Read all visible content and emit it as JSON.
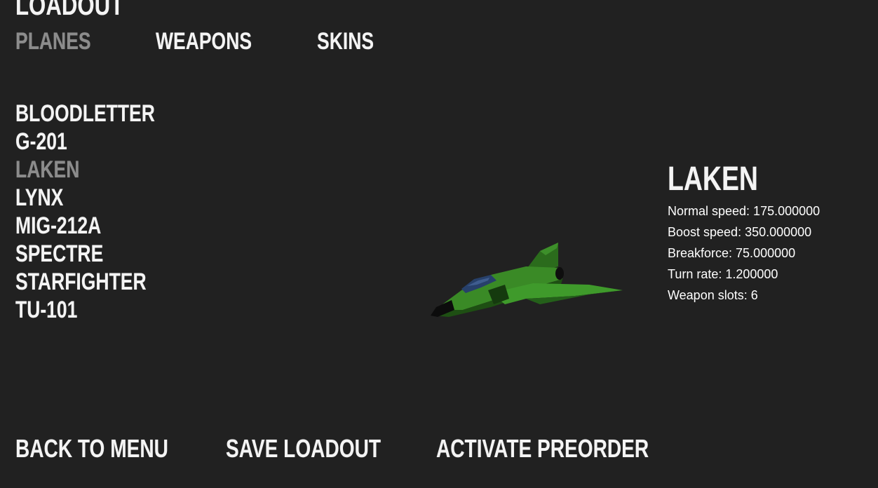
{
  "screen": {
    "title": "LOADOUT"
  },
  "tabs": [
    {
      "label": "PLANES",
      "active": true
    },
    {
      "label": "WEAPONS",
      "active": false
    },
    {
      "label": "SKINS",
      "active": false
    }
  ],
  "planes": [
    {
      "label": "BLOODLETTER",
      "selected": false
    },
    {
      "label": "G-201",
      "selected": false
    },
    {
      "label": "LAKEN",
      "selected": true
    },
    {
      "label": "LYNX",
      "selected": false
    },
    {
      "label": "MIG-212A",
      "selected": false
    },
    {
      "label": "SPECTRE",
      "selected": false
    },
    {
      "label": "STARFIGHTER",
      "selected": false
    },
    {
      "label": "TU-101",
      "selected": false
    }
  ],
  "selected_plane": {
    "name": "LAKEN",
    "stats": [
      {
        "text": "Normal speed: 175.000000"
      },
      {
        "text": "Boost speed: 350.000000"
      },
      {
        "text": "Breakforce: 75.000000"
      },
      {
        "text": "Turn rate: 1.200000"
      },
      {
        "text": "Weapon slots: 6"
      }
    ]
  },
  "actions": {
    "back": "BACK TO MENU",
    "save": "SAVE LOADOUT",
    "preorder": "ACTIVATE PREORDER"
  },
  "colors": {
    "background": "#212121",
    "text": "#f4f4f4",
    "inactive_text": "#8c8c8c",
    "plane_body": "#2f7a1f"
  }
}
